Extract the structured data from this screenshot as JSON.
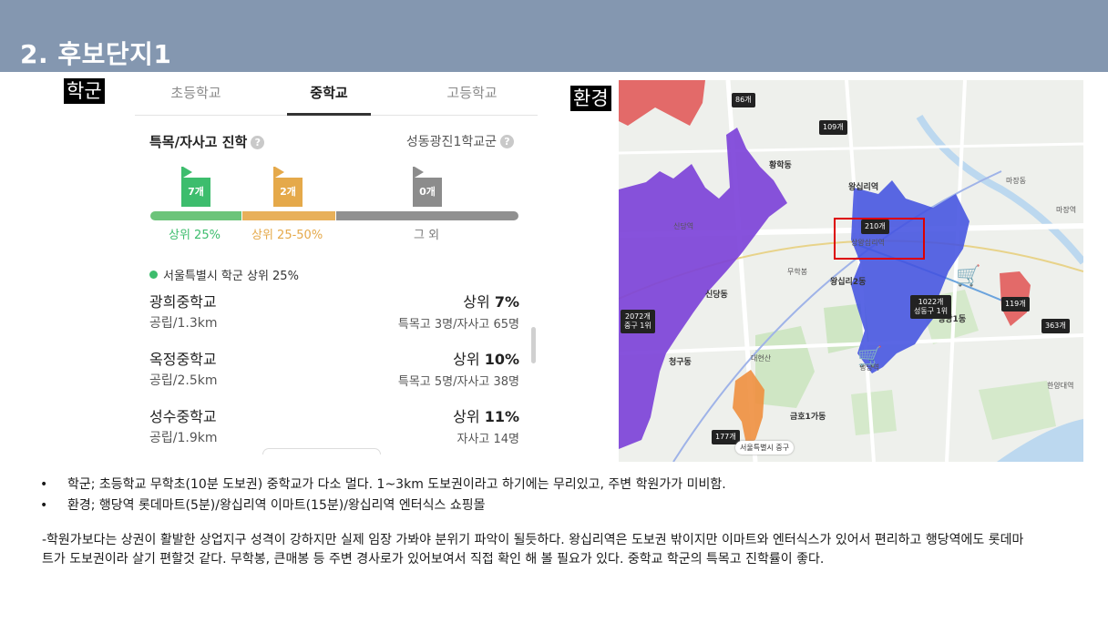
{
  "slide": {
    "title": "2. 후보단지1"
  },
  "tags": {
    "school": "학군",
    "environment": "환경"
  },
  "school_panel": {
    "tabs": [
      {
        "label": "초등학교"
      },
      {
        "label": "중학교"
      },
      {
        "label": "고등학교"
      }
    ],
    "section_title": "특목/자사고 진학",
    "district": "성동광진1학교군",
    "flags": [
      {
        "count": "7개",
        "color": "#3dbd6d"
      },
      {
        "count": "2개",
        "color": "#e5a94a"
      },
      {
        "count": "0개",
        "color": "#8c8c8c"
      }
    ],
    "bar_labels": [
      "상위 25%",
      "상위 25-50%",
      "그 외"
    ],
    "legend": "서울특별시 학군 상위 25%",
    "schools": [
      {
        "name": "광희중학교",
        "sub": "공립/1.3km",
        "rank_prefix": "상위",
        "rank_value": "7%",
        "info": "특목고 3명/자사고 65명"
      },
      {
        "name": "옥정중학교",
        "sub": "공립/2.5km",
        "rank_prefix": "상위",
        "rank_value": "10%",
        "info": "특목고 5명/자사고 38명"
      },
      {
        "name": "성수중학교",
        "sub": "공립/1.9km",
        "rank_prefix": "상위",
        "rank_value": "11%",
        "info": "자사고 14명"
      }
    ]
  },
  "map": {
    "labels": [
      {
        "text": "86개"
      },
      {
        "text": "109개"
      },
      {
        "text": "210개"
      },
      {
        "text": "1022개",
        "sub": "성동구 1위"
      },
      {
        "text": "2072개",
        "sub": "중구 1위"
      },
      {
        "text": "119개"
      },
      {
        "text": "363개"
      },
      {
        "text": "177개"
      }
    ],
    "place_names": [
      "왕십리역",
      "상왕십리역",
      "신당역",
      "행당1동",
      "행당역",
      "마장동",
      "왕십리2동",
      "신당동",
      "황학동",
      "청구동",
      "마장역",
      "한양대역",
      "무학봉",
      "대현산",
      "금호1가동"
    ],
    "bottom_label": "서울특별시 중구"
  },
  "bullets": [
    "학군; 초등학교 무학초(10분 도보권) 중학교가 다소 멀다. 1~3km 도보권이라고 하기에는 무리있고, 주변 학원가가 미비함.",
    "환경; 행당역 롯데마트(5분)/왕십리역 이마트(15분)/왕십리역 엔터식스 쇼핑몰"
  ],
  "paragraph": "-학원가보다는 상권이 활발한 상업지구 성격이 강하지만 실제 임장 가봐야 분위기 파악이 될듯하다. 왕십리역은 도보권 밖이지만 이마트와 엔터식스가 있어서 편리하고 행당역에도 롯데마트가 도보권이라 살기 편할것 같다. 무학봉, 큰매봉 등 주변 경사로가 있어보여서 직접 확인 해 볼 필요가 있다. 중학교 학군의 특목고 진학률이 좋다."
}
